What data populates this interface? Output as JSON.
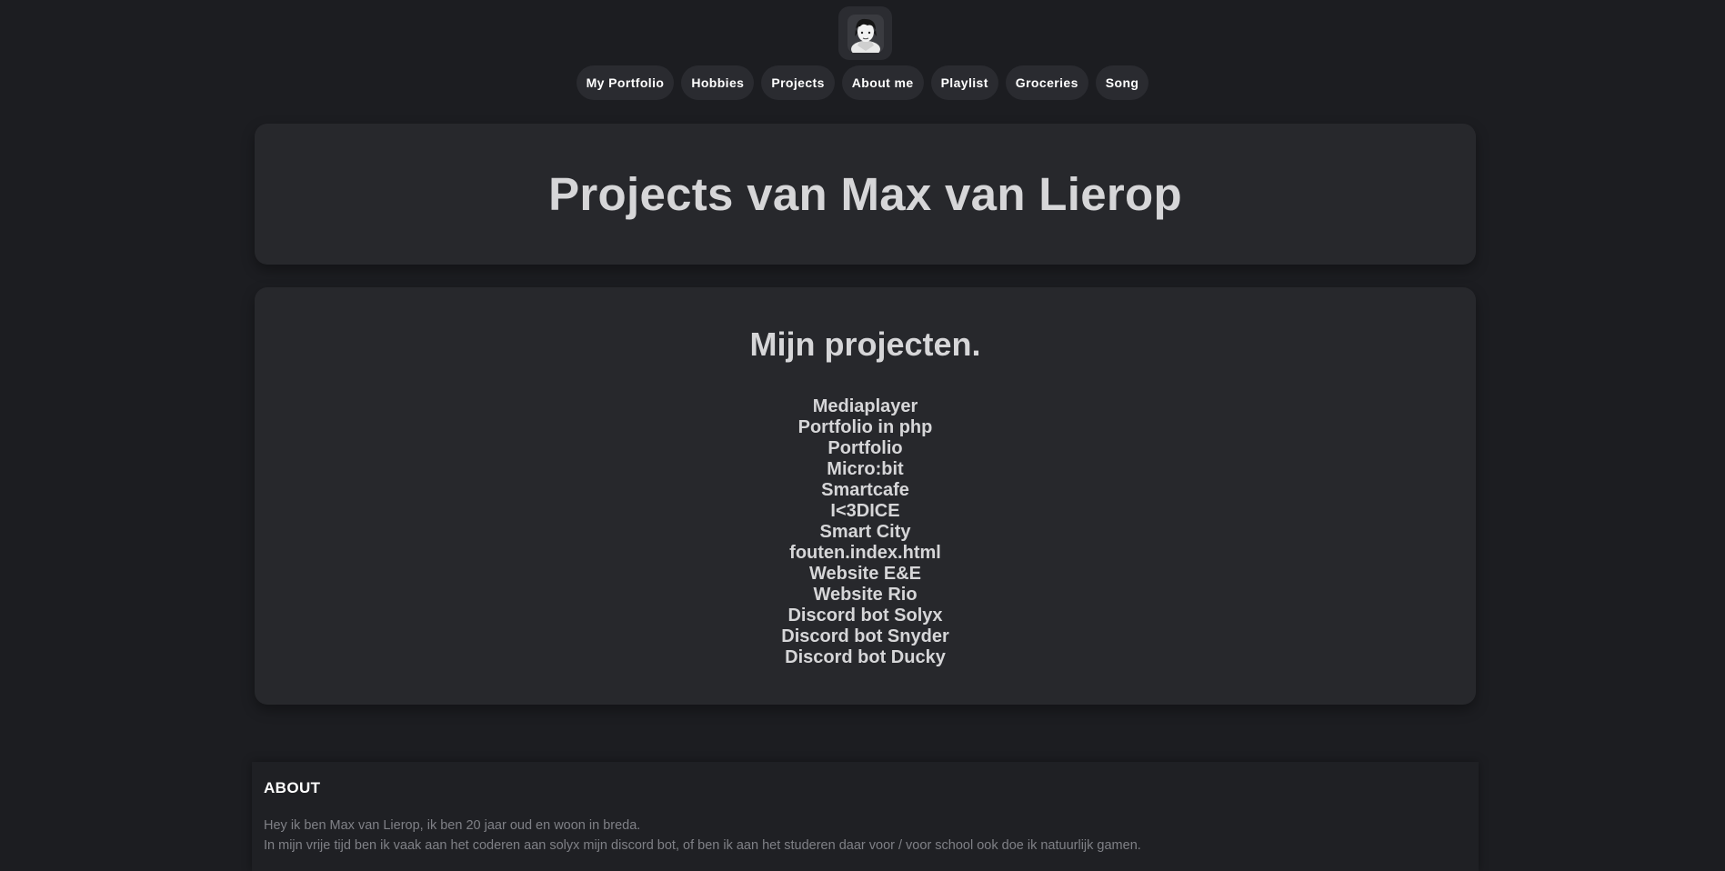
{
  "nav": {
    "items": [
      {
        "label": "My Portfolio"
      },
      {
        "label": "Hobbies"
      },
      {
        "label": "Projects"
      },
      {
        "label": "About me"
      },
      {
        "label": "Playlist"
      },
      {
        "label": "Groceries"
      },
      {
        "label": "Song"
      }
    ]
  },
  "header": {
    "avatar_icon": "profile-photo",
    "title": "Projects van Max van Lierop"
  },
  "projects": {
    "heading": "Mijn projecten.",
    "items": [
      "Mediaplayer",
      "Portfolio in php",
      "Portfolio",
      "Micro:bit",
      "Smartcafe",
      "I<3DICE",
      "Smart City",
      "fouten.index.html",
      "Website E&E",
      "Website Rio",
      "Discord bot Solyx",
      "Discord bot Snyder",
      "Discord bot Ducky"
    ]
  },
  "about": {
    "heading": "ABOUT",
    "line1": "Hey ik ben Max van Lierop, ik ben 20 jaar oud en woon in breda.",
    "line2": "In mijn vrije tijd ben ik vaak aan het coderen aan solyx mijn discord bot, of ben ik aan het studeren daar voor / voor school ook doe ik natuurlijk gamen."
  },
  "colors": {
    "background": "#1c1d21",
    "card": "#27282c",
    "pill": "#2a2b30",
    "text": "#d6d6d8",
    "muted_text": "#7f8086"
  }
}
